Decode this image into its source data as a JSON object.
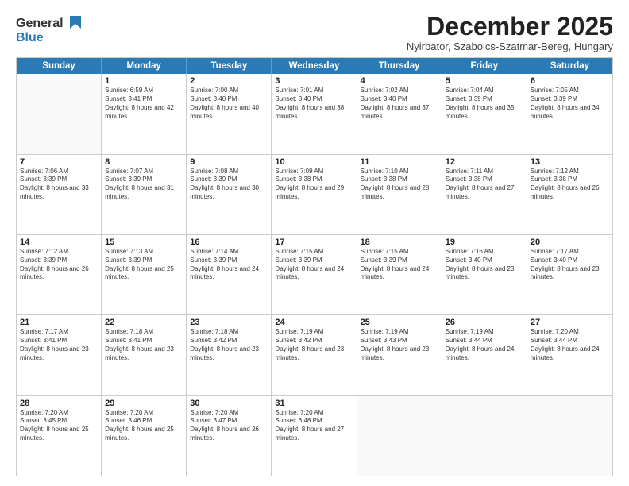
{
  "logo": {
    "general": "General",
    "blue": "Blue"
  },
  "header": {
    "month": "December 2025",
    "location": "Nyirbator, Szabolcs-Szatmar-Bereg, Hungary"
  },
  "weekdays": [
    "Sunday",
    "Monday",
    "Tuesday",
    "Wednesday",
    "Thursday",
    "Friday",
    "Saturday"
  ],
  "weeks": [
    [
      {
        "day": "",
        "sunrise": "",
        "sunset": "",
        "daylight": ""
      },
      {
        "day": "1",
        "sunrise": "Sunrise: 6:59 AM",
        "sunset": "Sunset: 3:41 PM",
        "daylight": "Daylight: 8 hours and 42 minutes."
      },
      {
        "day": "2",
        "sunrise": "Sunrise: 7:00 AM",
        "sunset": "Sunset: 3:40 PM",
        "daylight": "Daylight: 8 hours and 40 minutes."
      },
      {
        "day": "3",
        "sunrise": "Sunrise: 7:01 AM",
        "sunset": "Sunset: 3:40 PM",
        "daylight": "Daylight: 8 hours and 38 minutes."
      },
      {
        "day": "4",
        "sunrise": "Sunrise: 7:02 AM",
        "sunset": "Sunset: 3:40 PM",
        "daylight": "Daylight: 8 hours and 37 minutes."
      },
      {
        "day": "5",
        "sunrise": "Sunrise: 7:04 AM",
        "sunset": "Sunset: 3:39 PM",
        "daylight": "Daylight: 8 hours and 35 minutes."
      },
      {
        "day": "6",
        "sunrise": "Sunrise: 7:05 AM",
        "sunset": "Sunset: 3:39 PM",
        "daylight": "Daylight: 8 hours and 34 minutes."
      }
    ],
    [
      {
        "day": "7",
        "sunrise": "Sunrise: 7:06 AM",
        "sunset": "Sunset: 3:39 PM",
        "daylight": "Daylight: 8 hours and 33 minutes."
      },
      {
        "day": "8",
        "sunrise": "Sunrise: 7:07 AM",
        "sunset": "Sunset: 3:39 PM",
        "daylight": "Daylight: 8 hours and 31 minutes."
      },
      {
        "day": "9",
        "sunrise": "Sunrise: 7:08 AM",
        "sunset": "Sunset: 3:39 PM",
        "daylight": "Daylight: 8 hours and 30 minutes."
      },
      {
        "day": "10",
        "sunrise": "Sunrise: 7:09 AM",
        "sunset": "Sunset: 3:38 PM",
        "daylight": "Daylight: 8 hours and 29 minutes."
      },
      {
        "day": "11",
        "sunrise": "Sunrise: 7:10 AM",
        "sunset": "Sunset: 3:38 PM",
        "daylight": "Daylight: 8 hours and 28 minutes."
      },
      {
        "day": "12",
        "sunrise": "Sunrise: 7:11 AM",
        "sunset": "Sunset: 3:38 PM",
        "daylight": "Daylight: 8 hours and 27 minutes."
      },
      {
        "day": "13",
        "sunrise": "Sunrise: 7:12 AM",
        "sunset": "Sunset: 3:38 PM",
        "daylight": "Daylight: 8 hours and 26 minutes."
      }
    ],
    [
      {
        "day": "14",
        "sunrise": "Sunrise: 7:12 AM",
        "sunset": "Sunset: 3:39 PM",
        "daylight": "Daylight: 8 hours and 26 minutes."
      },
      {
        "day": "15",
        "sunrise": "Sunrise: 7:13 AM",
        "sunset": "Sunset: 3:39 PM",
        "daylight": "Daylight: 8 hours and 25 minutes."
      },
      {
        "day": "16",
        "sunrise": "Sunrise: 7:14 AM",
        "sunset": "Sunset: 3:39 PM",
        "daylight": "Daylight: 8 hours and 24 minutes."
      },
      {
        "day": "17",
        "sunrise": "Sunrise: 7:15 AM",
        "sunset": "Sunset: 3:39 PM",
        "daylight": "Daylight: 8 hours and 24 minutes."
      },
      {
        "day": "18",
        "sunrise": "Sunrise: 7:15 AM",
        "sunset": "Sunset: 3:39 PM",
        "daylight": "Daylight: 8 hours and 24 minutes."
      },
      {
        "day": "19",
        "sunrise": "Sunrise: 7:16 AM",
        "sunset": "Sunset: 3:40 PM",
        "daylight": "Daylight: 8 hours and 23 minutes."
      },
      {
        "day": "20",
        "sunrise": "Sunrise: 7:17 AM",
        "sunset": "Sunset: 3:40 PM",
        "daylight": "Daylight: 8 hours and 23 minutes."
      }
    ],
    [
      {
        "day": "21",
        "sunrise": "Sunrise: 7:17 AM",
        "sunset": "Sunset: 3:41 PM",
        "daylight": "Daylight: 8 hours and 23 minutes."
      },
      {
        "day": "22",
        "sunrise": "Sunrise: 7:18 AM",
        "sunset": "Sunset: 3:41 PM",
        "daylight": "Daylight: 8 hours and 23 minutes."
      },
      {
        "day": "23",
        "sunrise": "Sunrise: 7:18 AM",
        "sunset": "Sunset: 3:42 PM",
        "daylight": "Daylight: 8 hours and 23 minutes."
      },
      {
        "day": "24",
        "sunrise": "Sunrise: 7:19 AM",
        "sunset": "Sunset: 3:42 PM",
        "daylight": "Daylight: 8 hours and 23 minutes."
      },
      {
        "day": "25",
        "sunrise": "Sunrise: 7:19 AM",
        "sunset": "Sunset: 3:43 PM",
        "daylight": "Daylight: 8 hours and 23 minutes."
      },
      {
        "day": "26",
        "sunrise": "Sunrise: 7:19 AM",
        "sunset": "Sunset: 3:44 PM",
        "daylight": "Daylight: 8 hours and 24 minutes."
      },
      {
        "day": "27",
        "sunrise": "Sunrise: 7:20 AM",
        "sunset": "Sunset: 3:44 PM",
        "daylight": "Daylight: 8 hours and 24 minutes."
      }
    ],
    [
      {
        "day": "28",
        "sunrise": "Sunrise: 7:20 AM",
        "sunset": "Sunset: 3:45 PM",
        "daylight": "Daylight: 8 hours and 25 minutes."
      },
      {
        "day": "29",
        "sunrise": "Sunrise: 7:20 AM",
        "sunset": "Sunset: 3:46 PM",
        "daylight": "Daylight: 8 hours and 25 minutes."
      },
      {
        "day": "30",
        "sunrise": "Sunrise: 7:20 AM",
        "sunset": "Sunset: 3:47 PM",
        "daylight": "Daylight: 8 hours and 26 minutes."
      },
      {
        "day": "31",
        "sunrise": "Sunrise: 7:20 AM",
        "sunset": "Sunset: 3:48 PM",
        "daylight": "Daylight: 8 hours and 27 minutes."
      },
      {
        "day": "",
        "sunrise": "",
        "sunset": "",
        "daylight": ""
      },
      {
        "day": "",
        "sunrise": "",
        "sunset": "",
        "daylight": ""
      },
      {
        "day": "",
        "sunrise": "",
        "sunset": "",
        "daylight": ""
      }
    ]
  ]
}
